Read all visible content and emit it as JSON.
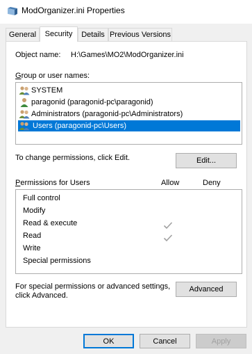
{
  "window": {
    "title": "ModOrganizer.ini Properties",
    "icon": "file-icon"
  },
  "tabs": [
    {
      "label": "General",
      "active": false
    },
    {
      "label": "Security",
      "active": true
    },
    {
      "label": "Details",
      "active": false
    },
    {
      "label": "Previous Versions",
      "active": false
    }
  ],
  "object": {
    "label": "Object name:",
    "value": "H:\\Games\\MO2\\ModOrganizer.ini"
  },
  "groups": {
    "label": "Group or user names:",
    "items": [
      {
        "name": "SYSTEM",
        "icon": "group-icon",
        "selected": false
      },
      {
        "name": "paragonid (paragonid-pc\\paragonid)",
        "icon": "user-icon",
        "selected": false
      },
      {
        "name": "Administrators (paragonid-pc\\Administrators)",
        "icon": "group-icon",
        "selected": false
      },
      {
        "name": "Users (paragonid-pc\\Users)",
        "icon": "group-icon",
        "selected": true
      }
    ]
  },
  "change_text": "To change permissions, click Edit.",
  "edit_button": "Edit...",
  "permissions": {
    "header": "Permissions for Users",
    "allow_header": "Allow",
    "deny_header": "Deny",
    "rows": [
      {
        "name": "Full control",
        "allow": false,
        "deny": false
      },
      {
        "name": "Modify",
        "allow": false,
        "deny": false
      },
      {
        "name": "Read & execute",
        "allow": true,
        "deny": false
      },
      {
        "name": "Read",
        "allow": true,
        "deny": false
      },
      {
        "name": "Write",
        "allow": false,
        "deny": false
      },
      {
        "name": "Special permissions",
        "allow": false,
        "deny": false
      }
    ]
  },
  "advanced_text": "For special permissions or advanced settings, click Advanced.",
  "advanced_text_line1": "For special permissions or advanced settings,",
  "advanced_text_line2": "click Advanced.",
  "advanced_button": "Advanced",
  "footer": {
    "ok": "OK",
    "cancel": "Cancel",
    "apply": "Apply"
  },
  "colors": {
    "selection": "#0078d7",
    "check_disabled": "#a0a0a0"
  }
}
